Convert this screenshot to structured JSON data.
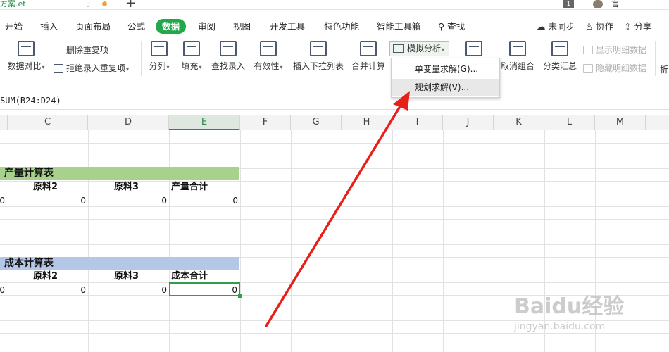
{
  "titlebar": {
    "file_tab": "方案.et",
    "badge": "1",
    "user_label": "言"
  },
  "menu": {
    "tabs": [
      "开始",
      "插入",
      "页面布局",
      "公式",
      "数据",
      "审阅",
      "视图",
      "开发工具",
      "特色功能",
      "智能工具箱"
    ],
    "active_tab": "数据",
    "search": "查找",
    "sync": "未同步",
    "collab": "协作",
    "share": "分享"
  },
  "ribbon": {
    "data_compare": "数据对比",
    "remove_duplicates": "删除重复项",
    "reject_duplicates": "拒绝录入重复项",
    "split_column": "分列",
    "fill": "填充",
    "find_entry": "查找录入",
    "validity": "有效性",
    "insert_dropdown": "插入下拉列表",
    "merge_calc": "合并计算",
    "simulation": "模拟分析",
    "ungroup": "取消组合",
    "subtotal": "分类汇总",
    "show_detail": "显示明细数据",
    "hide_detail": "隐藏明细数据",
    "fold": "折"
  },
  "dropdown": {
    "items": [
      "单变量求解(G)...",
      "规划求解(V)..."
    ],
    "hovered_index": 1
  },
  "formula_bar": {
    "formula": "SUM(B24:D24)"
  },
  "columns": [
    "C",
    "D",
    "E",
    "F",
    "G",
    "H",
    "I",
    "J",
    "K",
    "L",
    "M"
  ],
  "selected_column": "E",
  "sheet": {
    "production": {
      "title": "产量计算表",
      "headers": [
        "原料2",
        "原料3",
        "产量合计"
      ],
      "values": [
        "0",
        "0",
        "0",
        "0"
      ],
      "band_color": "#a9d18e"
    },
    "cost": {
      "title": "成本计算表",
      "headers": [
        "原料2",
        "原料3",
        "成本合计"
      ],
      "values": [
        "0",
        "0",
        "0",
        "0"
      ],
      "band_color": "#b4c7e7"
    }
  },
  "accent_color": "#22a84a",
  "arrow_color": "#e8201a",
  "watermark": {
    "logo": "Baidu经验",
    "url": "jingyan.baidu.com"
  }
}
